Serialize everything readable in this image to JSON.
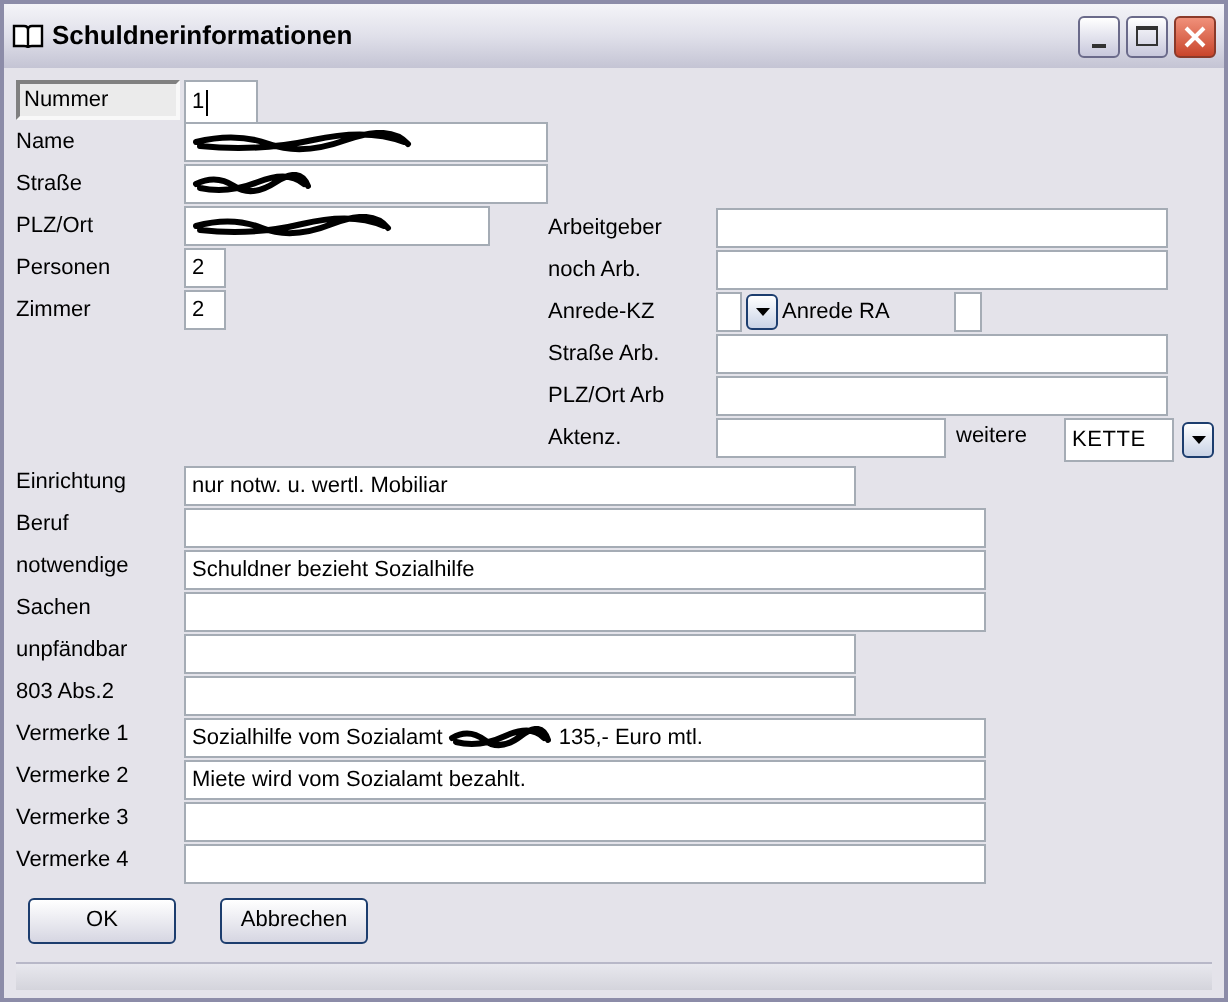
{
  "window": {
    "title": "Schuldnerinformationen"
  },
  "personal": [
    {
      "label": "Nummer",
      "value": "1",
      "kind": "focused"
    },
    {
      "label": "Name",
      "kind": "redacted"
    },
    {
      "label": "Straße",
      "kind": "redacted"
    },
    {
      "label": "PLZ/Ort",
      "kind": "redacted"
    },
    {
      "label": "Personen",
      "value": "2",
      "kind": "small"
    },
    {
      "label": "Zimmer",
      "value": "2",
      "kind": "small"
    }
  ],
  "employer": [
    {
      "label": "Arbeitgeber",
      "kind": "wide"
    },
    {
      "label": "noch Arb.",
      "kind": "wide"
    },
    {
      "label": "Anrede-KZ",
      "kind": "anrede",
      "second_label": "Anrede RA"
    },
    {
      "label": "Straße Arb.",
      "kind": "wide"
    },
    {
      "label": "PLZ/Ort Arb",
      "kind": "wide"
    },
    {
      "label": "Aktenz.",
      "kind": "aktenz",
      "second_label": "weitere",
      "second_value": "KETTE"
    }
  ],
  "details": [
    {
      "label": "Einrichtung",
      "value": "nur notw. u. wertl. Mobiliar",
      "kind": "medium"
    },
    {
      "label": "Beruf",
      "kind": "wide"
    },
    {
      "label": "notwendige",
      "value": "Schuldner bezieht Sozialhilfe",
      "kind": "wide"
    },
    {
      "label": "Sachen",
      "kind": "wide"
    },
    {
      "label": "unpfändbar",
      "kind": "medium"
    },
    {
      "label": "803 Abs.2",
      "kind": "medium"
    },
    {
      "label": "Vermerke 1",
      "value": "Sozialhilfe vom Sozialamt",
      "value_after": "135,- Euro mtl.",
      "kind": "redacted_note"
    },
    {
      "label": "Vermerke 2",
      "value": "Miete wird vom Sozialamt bezahlt.",
      "kind": "wide"
    },
    {
      "label": "Vermerke 3",
      "kind": "wide"
    },
    {
      "label": "Vermerke 4",
      "kind": "wide"
    }
  ],
  "buttons": [
    "OK",
    "Abbrechen"
  ]
}
